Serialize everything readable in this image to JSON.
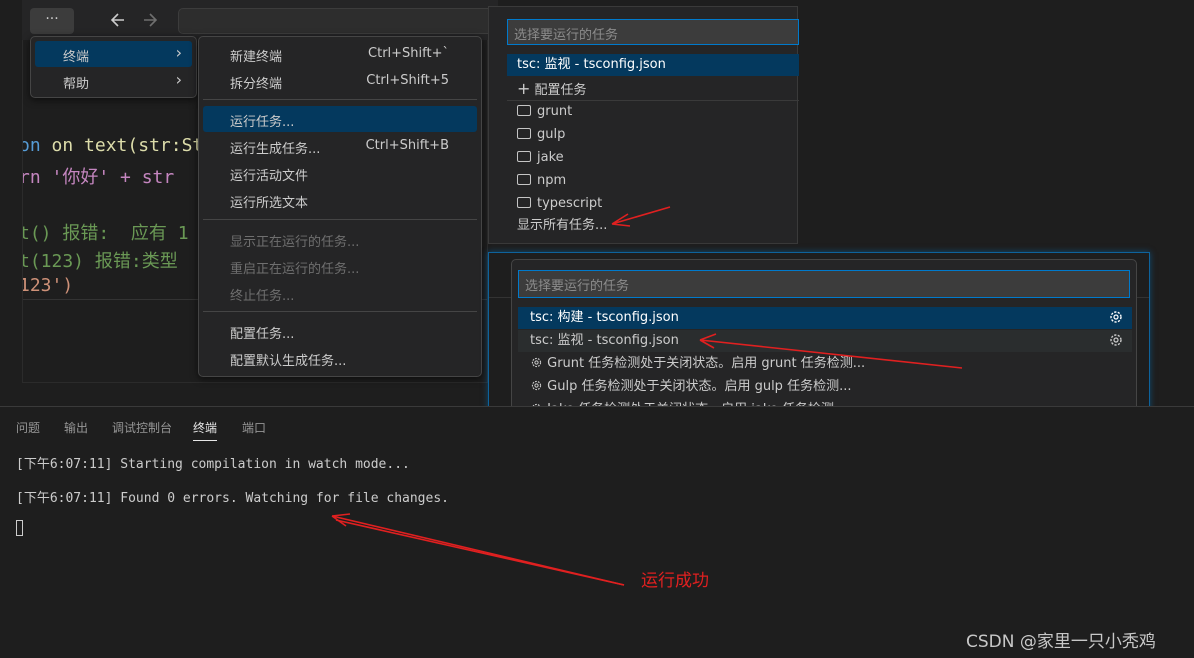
{
  "titlebar": {
    "more_label": "···"
  },
  "code_lines": [
    {
      "text": "on text(str:Stri"
    },
    {
      "text": "rn '你好' + str"
    },
    {
      "text": "t() 报错:  应有 1"
    },
    {
      "text": "t(123) 报错:类型"
    },
    {
      "text": "123')"
    }
  ],
  "menubar": {
    "items": [
      {
        "label": "终端",
        "arrow": "›"
      },
      {
        "label": "帮助",
        "arrow": "›"
      }
    ]
  },
  "terminal_menu": {
    "items": [
      {
        "label": "新建终端",
        "shortcut": "Ctrl+Shift+`"
      },
      {
        "label": "拆分终端",
        "shortcut": "Ctrl+Shift+5"
      },
      {
        "label": "运行任务...",
        "shortcut": ""
      },
      {
        "label": "运行生成任务...",
        "shortcut": "Ctrl+Shift+B"
      },
      {
        "label": "运行活动文件",
        "shortcut": ""
      },
      {
        "label": "运行所选文本",
        "shortcut": ""
      },
      {
        "label": "显示正在运行的任务...",
        "shortcut": ""
      },
      {
        "label": "重启正在运行的任务...",
        "shortcut": ""
      },
      {
        "label": "终止任务...",
        "shortcut": ""
      },
      {
        "label": "配置任务...",
        "shortcut": ""
      },
      {
        "label": "配置默认生成任务...",
        "shortcut": ""
      }
    ]
  },
  "quickpick1": {
    "placeholder": "选择要运行的任务",
    "items": [
      {
        "label": "tsc: 监视 - tsconfig.json"
      },
      {
        "label": "配置任务"
      },
      {
        "label": "grunt"
      },
      {
        "label": "gulp"
      },
      {
        "label": "jake"
      },
      {
        "label": "npm"
      },
      {
        "label": "typescript"
      },
      {
        "label": "显示所有任务..."
      }
    ]
  },
  "quickpick2": {
    "placeholder": "选择要运行的任务",
    "items": [
      {
        "label": "tsc: 构建 - tsconfig.json"
      },
      {
        "label": "tsc: 监视 - tsconfig.json"
      },
      {
        "label": "Grunt 任务检测处于关闭状态。启用 grunt 任务检测..."
      },
      {
        "label": "Gulp 任务检测处于关闭状态。启用 gulp 任务检测..."
      },
      {
        "label": "Jake 任务检测处于关闭状态。启用 jake 任务检测..."
      }
    ]
  },
  "panel": {
    "tabs": [
      {
        "label": "问题"
      },
      {
        "label": "输出"
      },
      {
        "label": "调试控制台"
      },
      {
        "label": "终端"
      },
      {
        "label": "端口"
      }
    ],
    "active_tab": "终端",
    "lines": [
      {
        "text": "[下午6:07:11] Starting compilation in watch mode..."
      },
      {
        "text": "[下午6:07:11] Found 0 errors. Watching for file changes."
      }
    ]
  },
  "annotation": {
    "label": "运行成功",
    "color": "#e02020"
  },
  "watermark": "CSDN @家里一只小秃鸡",
  "colors": {
    "accent": "#007acc",
    "selection": "#04395e",
    "arrow": "#e02020"
  }
}
